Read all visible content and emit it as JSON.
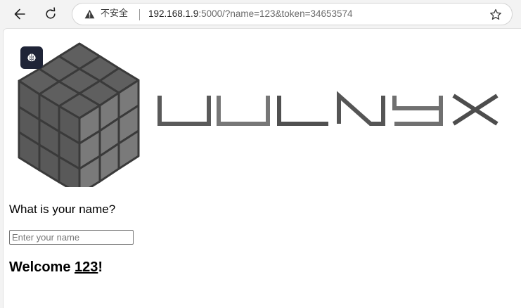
{
  "browser": {
    "security_label": "不安全",
    "url_host": "192.168.1.9",
    "url_rest": ":5000/?name=123&token=34653574"
  },
  "page": {
    "logo_text": "VULNYX",
    "question": "What is your name?",
    "name_input": {
      "placeholder": "Enter your name",
      "value": ""
    },
    "welcome": {
      "prefix": "Welcome ",
      "name": "123",
      "suffix": "!"
    }
  }
}
